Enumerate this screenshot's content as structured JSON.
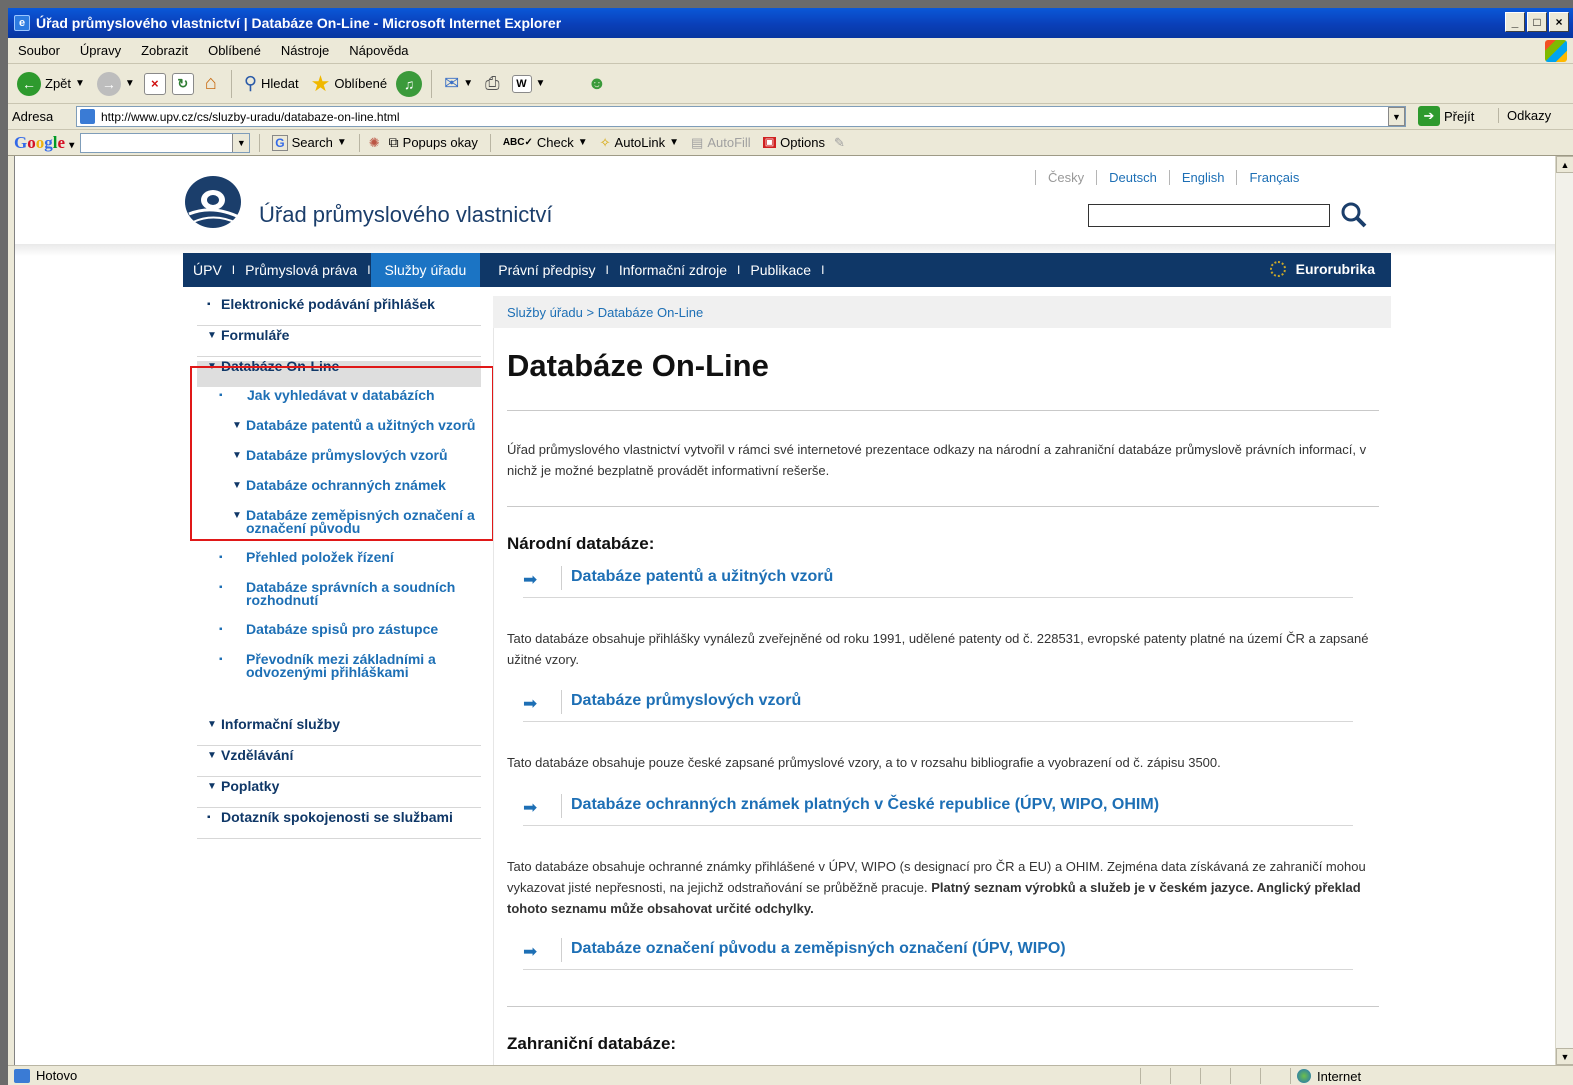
{
  "window": {
    "title": "Úřad průmyslového vlastnictví | Databáze On-Line - Microsoft Internet Explorer",
    "min": "_",
    "max": "□",
    "close": "×"
  },
  "menubar": [
    "Soubor",
    "Úpravy",
    "Zobrazit",
    "Oblíbené",
    "Nástroje",
    "Nápověda"
  ],
  "toolbar": {
    "back": "Zpět",
    "search": "Hledat",
    "favorites": "Oblíbené"
  },
  "address": {
    "label": "Adresa",
    "url": "http://www.upv.cz/cs/sluzby-uradu/databaze-on-line.html",
    "go": "Přejít",
    "links": "Odkazy"
  },
  "google_toolbar": {
    "search": "Search",
    "popups": "Popups okay",
    "check": "Check",
    "autolink": "AutoLink",
    "autofill": "AutoFill",
    "options": "Options"
  },
  "site": {
    "name": "Úřad průmyslového vlastnictví",
    "languages": [
      "Česky",
      "Deutsch",
      "English",
      "Français"
    ],
    "nav": [
      "ÚPV",
      "Průmyslová práva",
      "Služby úřadu",
      "Právní předpisy",
      "Informační zdroje",
      "Publikace"
    ],
    "nav_active": "Služby úřadu",
    "eurorubrika": "Eurorubrika"
  },
  "left_menu": {
    "top": [
      "Elektronické podávání přihlášek",
      "Formuláře",
      "Databáze On-Line"
    ],
    "sub": [
      "Jak vyhledávat v databázích",
      "Databáze patentů a užitných vzorů",
      "Databáze průmyslových vzorů",
      "Databáze ochranných známek",
      "Databáze zeměpisných označení a označení původu",
      "Přehled položek řízení",
      "Databáze správních a soudních rozhodnutí",
      "Databáze spisů pro zástupce",
      "Převodník mezi základními a odvozenými přihláškami"
    ],
    "bottom": [
      "Informační služby",
      "Vzdělávání",
      "Poplatky",
      "Dotazník spokojenosti se službami"
    ]
  },
  "content": {
    "breadcrumb": "Služby úřadu > Databáze On-Line",
    "title": "Databáze On-Line",
    "intro": "Úřad průmyslového vlastnictví vytvořil v rámci své internetové prezentace odkazy na národní a zahraniční databáze průmyslově právních informací, v nichž je možné bezplatně provádět informativní rešerše.",
    "national_heading": "Národní databáze:",
    "databases": [
      {
        "link": "Databáze patentů a užitných vzorů",
        "desc": "Tato databáze obsahuje přihlášky vynálezů zveřejněné od roku 1991, udělené patenty od č. 228531, evropské patenty platné na území ČR a zapsané užitné vzory."
      },
      {
        "link": "Databáze průmyslových vzorů",
        "desc": "Tato databáze obsahuje pouze české zapsané průmyslové vzory, a to v rozsahu bibliografie a vyobrazení od č. zápisu 3500."
      },
      {
        "link": "Databáze ochranných známek platných v České republice (ÚPV, WIPO, OHIM)",
        "desc": "Tato databáze obsahuje ochranné známky přihlášené v ÚPV, WIPO (s designací pro ČR a EU) a OHIM. Zejména data získávaná ze zahraničí mohou vykazovat jisté nepřesnosti, na jejichž odstraňování se průběžně pracuje.",
        "desc_bold": "Platný seznam výrobků a služeb je v českém jazyce. Anglický překlad tohoto seznamu může obsahovat určité odchylky."
      },
      {
        "link": "Databáze označení původu a zeměpisných označení (ÚPV, WIPO)"
      }
    ],
    "foreign_heading": "Zahraniční databáze:"
  },
  "status": {
    "left": "Hotovo",
    "zone": "Internet"
  }
}
